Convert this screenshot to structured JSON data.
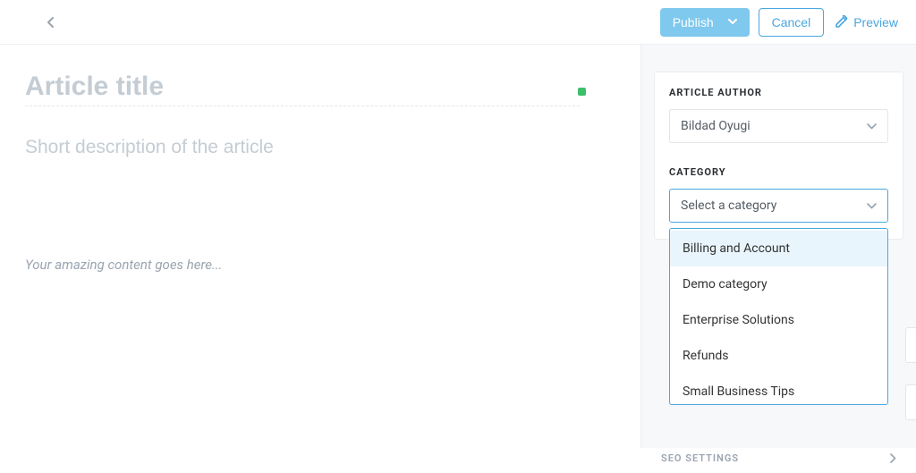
{
  "topbar": {
    "publish_label": "Publish",
    "cancel_label": "Cancel",
    "preview_label": "Preview"
  },
  "editor": {
    "title_placeholder": "Article title",
    "desc_placeholder": "Short description of the article",
    "content_placeholder": "Your amazing content goes here..."
  },
  "sidebar": {
    "author_label": "Article Author",
    "author_value": "Bildad Oyugi",
    "category_label": "Category",
    "category_placeholder": "Select a category",
    "category_options": {
      "0": "Billing and Account",
      "1": "Demo category",
      "2": "Enterprise Solutions",
      "3": "Refunds",
      "4": "Small Business Tips"
    },
    "seo_label": "SEO Settings"
  }
}
